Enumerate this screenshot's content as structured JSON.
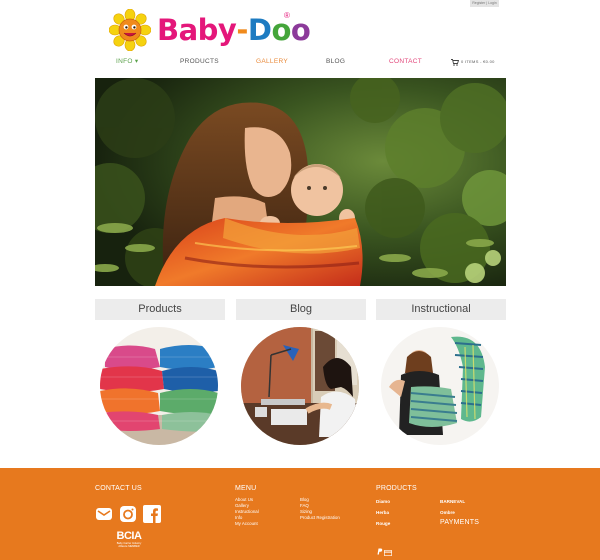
{
  "top_bar": {
    "links": "Register | Login"
  },
  "brand": {
    "letters": [
      "Baby",
      "-",
      "D",
      "o",
      "o"
    ],
    "reg": "®"
  },
  "nav": {
    "info": "INFO ▾",
    "products": "PRODUCTS",
    "gallery": "GALLERY",
    "blog": "BLOG",
    "contact": "CONTACT",
    "cart_text": "0 ITEMS - €0.00"
  },
  "sections": {
    "products": "Products",
    "blog": "Blog",
    "instructional": "Instructional"
  },
  "footer": {
    "contact_heading": "CONTACT US",
    "menu_heading": "MENU",
    "menu_col1": [
      "About Us",
      "Gallery",
      "Instructional",
      "Info",
      "My Account"
    ],
    "menu_col2": [
      "Blog",
      "FAQ",
      "Sizing",
      "Product Registration"
    ],
    "products_heading": "PRODUCTS",
    "products_col1": [
      "Diamo",
      "Herba",
      "Rouge"
    ],
    "products_col2": [
      "BARNEVAL",
      "Ombre"
    ],
    "payments_heading": "PAYMENTS",
    "bcia_badge": "BCIA",
    "bcia_sub": "Baby Carrier Industry Alliance MEMBER"
  },
  "colors": {
    "footer_orange": "#e7791e",
    "info_green": "#5aa14a",
    "gallery_orange": "#e98a3a",
    "contact_pink": "#e2467a"
  },
  "icons": {
    "cart": "cart-icon",
    "email": "email-icon",
    "instagram": "instagram-icon",
    "facebook": "facebook-icon",
    "paypal": "paypal-icon",
    "card": "credit-card-icon"
  }
}
